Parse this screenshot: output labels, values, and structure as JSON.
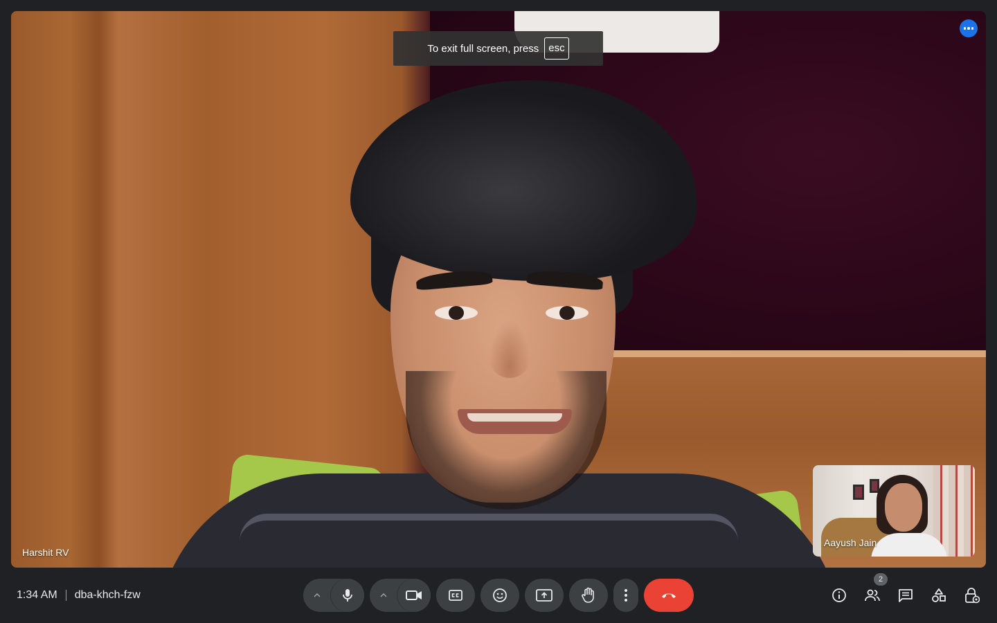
{
  "main_video": {
    "participant_name": "Harshit RV"
  },
  "fullscreen_toast": {
    "message": "To exit full screen, press",
    "key": "esc"
  },
  "self_view": {
    "participant_name": "Aayush Jain"
  },
  "meeting": {
    "time": "1:34 AM",
    "code": "dba-khch-fzw"
  },
  "controls": {
    "icons": [
      "microphone-options-chevron-icon",
      "microphone-icon",
      "camera-options-chevron-icon",
      "camera-icon",
      "captions-icon",
      "emoji-reaction-icon",
      "present-screen-icon",
      "raise-hand-icon",
      "more-options-icon",
      "end-call-icon"
    ],
    "end_call_color": "#ea4335"
  },
  "right_panel": {
    "participants_count": "2",
    "icons": [
      "meeting-details-icon",
      "people-icon",
      "chat-icon",
      "activities-icon",
      "host-controls-icon"
    ]
  },
  "colors": {
    "background": "#202124",
    "button": "#3c4043",
    "accent": "#1a73e8"
  }
}
